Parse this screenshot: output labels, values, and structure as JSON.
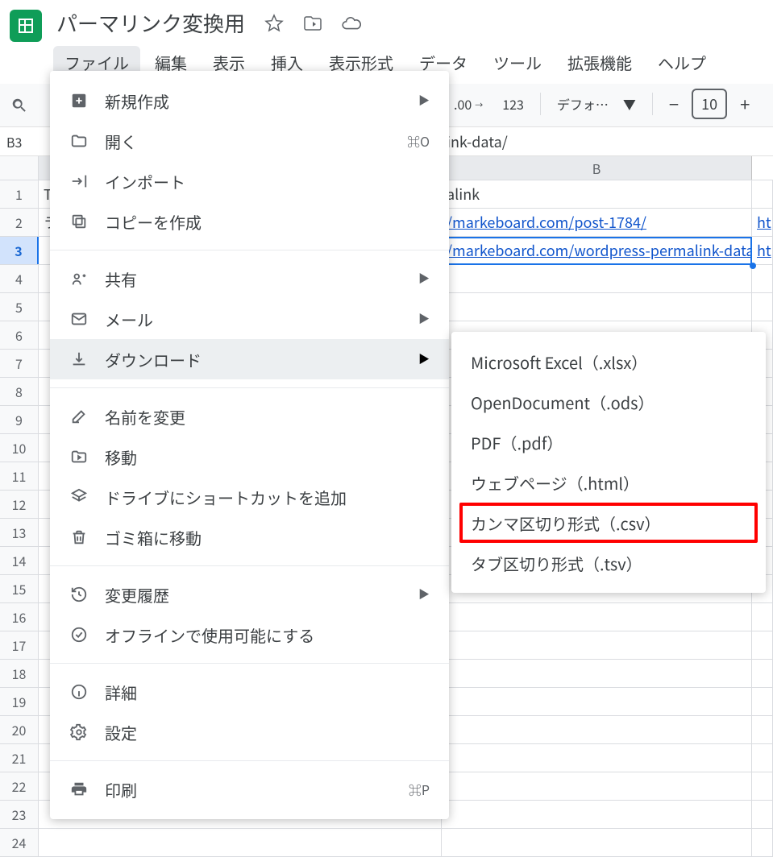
{
  "header": {
    "title": "パーマリンク変換用"
  },
  "menubar": {
    "items": [
      "ファイル",
      "編集",
      "表示",
      "挿入",
      "表示形式",
      "データ",
      "ツール",
      "拡張機能",
      "ヘルプ"
    ],
    "active_index": 0
  },
  "toolbar": {
    "decimal_more": ".00",
    "format_123": "123",
    "font_label": "デフォ…",
    "minus": "−",
    "font_size": "10",
    "plus": "+"
  },
  "formula_bar": {
    "cell_ref": "B3",
    "value_fragment": "ink-data/"
  },
  "columns": {
    "b_label": "B"
  },
  "rows": {
    "labels": [
      "1",
      "2",
      "3",
      "4",
      "5",
      "6",
      "7",
      "8",
      "9",
      "10",
      "11",
      "12",
      "13",
      "14",
      "15",
      "16",
      "17",
      "18",
      "19",
      "20",
      "21",
      "22",
      "23",
      "24"
    ],
    "selected": 3
  },
  "cells": {
    "a1_fragment": "T",
    "a2_fragment": "ラ",
    "b1_fragment": "alink",
    "b2_fragment": "/markeboard.com/post-1784/",
    "b3_fragment": "/markeboard.com/wordpress-permalink-data/",
    "c2_fragment": "ht",
    "c3_fragment": "ht"
  },
  "menu": {
    "items": [
      {
        "label": "新規作成",
        "icon": "plus-box",
        "submenu": true
      },
      {
        "label": "開く",
        "icon": "folder",
        "shortcut": "⌘O"
      },
      {
        "label": "インポート",
        "icon": "import"
      },
      {
        "label": "コピーを作成",
        "icon": "copy"
      },
      {
        "sep": true
      },
      {
        "label": "共有",
        "icon": "share",
        "submenu": true
      },
      {
        "label": "メール",
        "icon": "mail",
        "submenu": true
      },
      {
        "label": "ダウンロード",
        "icon": "download",
        "submenu": true,
        "hover": true
      },
      {
        "sep": true
      },
      {
        "label": "名前を変更",
        "icon": "rename"
      },
      {
        "label": "移動",
        "icon": "move"
      },
      {
        "label": "ドライブにショートカットを追加",
        "icon": "shortcut"
      },
      {
        "label": "ゴミ箱に移動",
        "icon": "trash"
      },
      {
        "sep": true
      },
      {
        "label": "変更履歴",
        "icon": "history",
        "submenu": true
      },
      {
        "label": "オフラインで使用可能にする",
        "icon": "offline"
      },
      {
        "sep": true
      },
      {
        "label": "詳細",
        "icon": "info"
      },
      {
        "label": "設定",
        "icon": "settings"
      },
      {
        "sep": true
      },
      {
        "label": "印刷",
        "icon": "print",
        "shortcut": "⌘P"
      }
    ]
  },
  "submenu": {
    "items": [
      "Microsoft Excel（.xlsx）",
      "OpenDocument（.ods）",
      "PDF（.pdf）",
      "ウェブページ（.html）",
      "カンマ区切り形式（.csv）",
      "タブ区切り形式（.tsv）"
    ],
    "highlighted_index": 4
  }
}
